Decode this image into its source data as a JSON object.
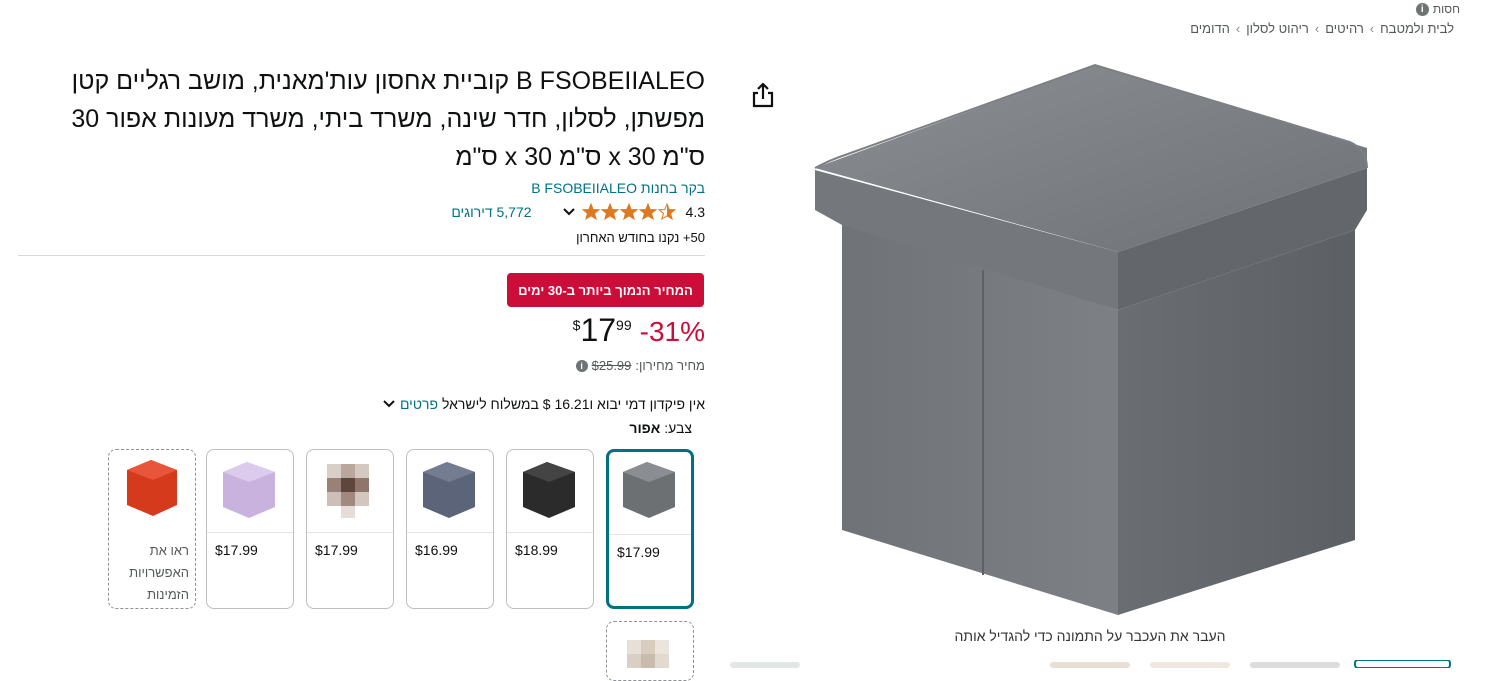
{
  "top": {
    "sponsored_label": "חסות"
  },
  "breadcrumbs": [
    "לבית ולמטבח",
    "רהיטים",
    "ריהוט לסלון",
    "הדומים"
  ],
  "product": {
    "title_line1": "B FSOBEIIALEO קוביית אחסון עות'מאנית, מושב רגליים קטן",
    "title_line2": "מפשתן, לסלון, חדר שינה, משרד ביתי, משרד מעונות אפור 30",
    "title_line3": "ס\"מ 30 x ס\"מ 30 x ס\"מ",
    "store_link": "בקר בחנות B FSOBEIIALEO",
    "rating": "4.3",
    "ratings_count": "5,772 דירוגים",
    "bought": "50+ נקנו בחודש האחרון",
    "deal_badge": "המחיר הנמוך ביותר ב-30 ימים",
    "discount": "-31%",
    "price": {
      "symbol": "$",
      "whole": "17",
      "fraction": "99"
    },
    "list_price_label": "מחיר מחירון:",
    "list_price": "$25.99",
    "shipping_text": "אין פיקדון דמי יבוא ו16.21 $ במשלוח לישראל",
    "shipping_link": "פרטים",
    "color_label": "צבע:",
    "color_value": "אפור",
    "hover_hint": "העבר את העכבר על התמונה כדי להגדיל אותה"
  },
  "swatches": [
    {
      "price": "$17.99",
      "color": "#6d7073",
      "selected": true
    },
    {
      "price": "$18.99",
      "color": "#2b2b2b"
    },
    {
      "price": "$16.99",
      "color": "#5b6478"
    },
    {
      "price": "$17.99",
      "color": "#8a6f63"
    },
    {
      "price": "$17.99",
      "color": "#c9b3de"
    }
  ],
  "see_options": "ראו את האפשרויות הזמינות",
  "colors": {
    "link": "#007185",
    "deal": "#cc0c39",
    "star": "#de7921"
  }
}
